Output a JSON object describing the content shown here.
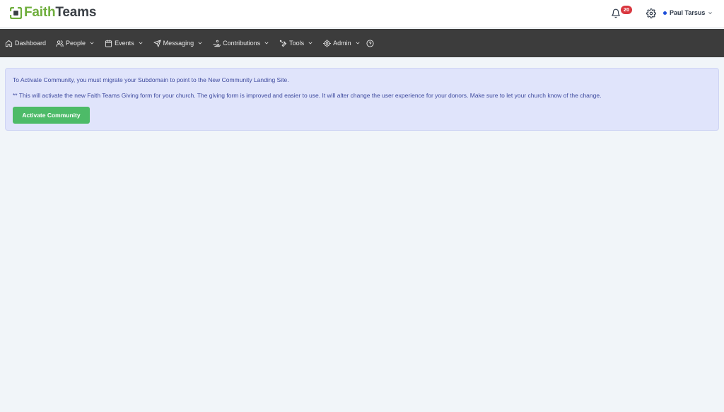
{
  "brand": {
    "part1": "Faith",
    "part2": "Teams"
  },
  "header": {
    "notification_count": "20",
    "user_name": "Paul Tarsus"
  },
  "nav": {
    "dashboard": "Dashboard",
    "people": "People",
    "events": "Events",
    "messaging": "Messaging",
    "contributions": "Contributions",
    "tools": "Tools",
    "admin": "Admin"
  },
  "alert": {
    "line1": "To Activate Community, you must migrate your Subdomain to point to the New Community Landing Site.",
    "line2": "** This will activate the new Faith Teams Giving form for your church. The giving form is improved and easier to use. It will alter change the user experience for your donors. Make sure to let your church know of the change.",
    "button_label": "Activate Community"
  },
  "colors": {
    "brand_green": "#6fae3d",
    "navbar_bg": "#3c3c3c",
    "alert_bg": "#e0e4fb",
    "alert_text": "#3e4a9e",
    "button_green": "#4dbb68",
    "badge_red": "#d9363e"
  }
}
